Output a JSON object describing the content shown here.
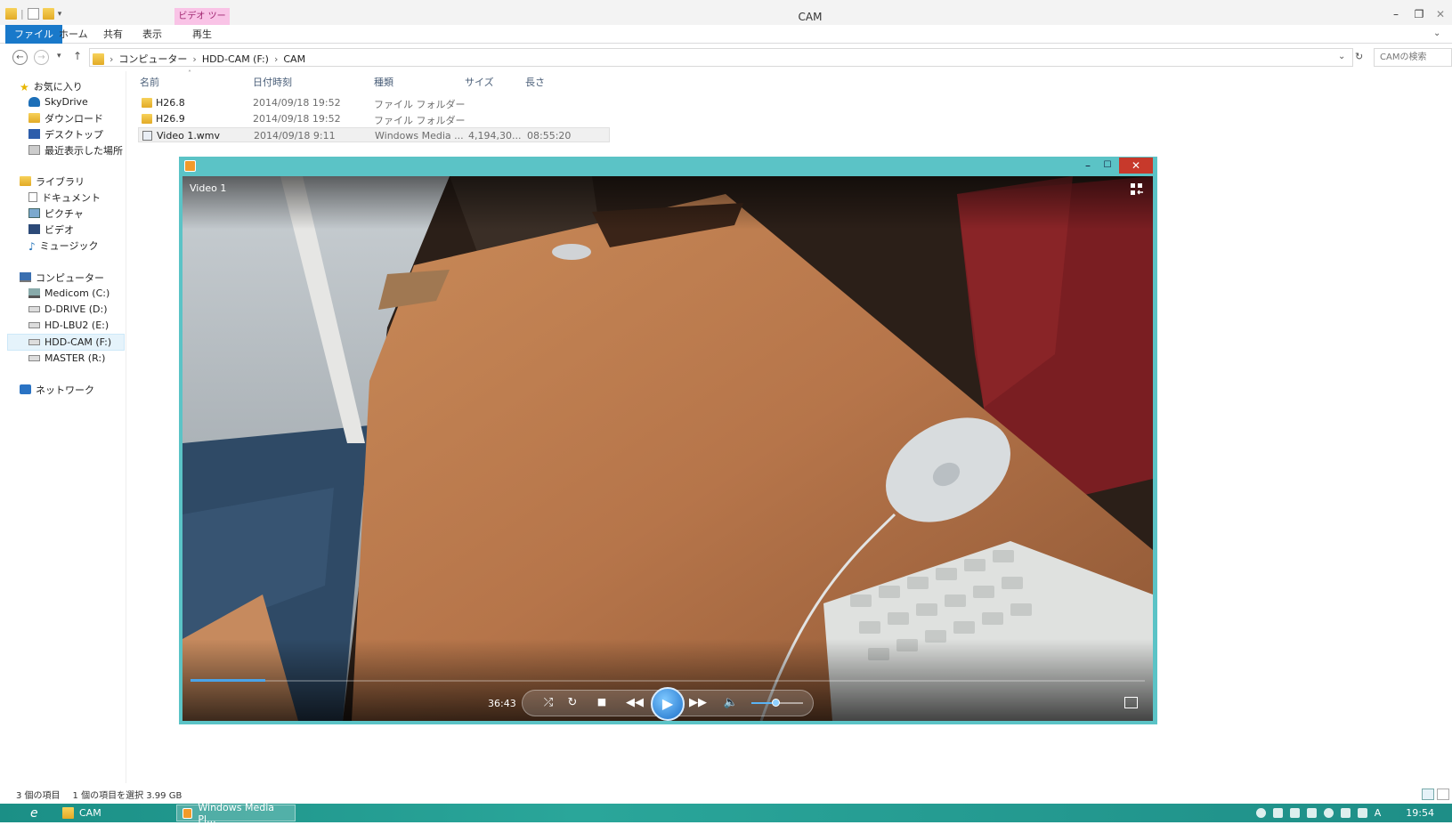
{
  "explorer": {
    "window_title": "CAM",
    "context_tab": "ビデオ ツール",
    "ribbon_tabs": [
      "ファイル",
      "ホーム",
      "共有",
      "表示",
      "再生"
    ],
    "breadcrumb": [
      "コンピューター",
      "HDD-CAM (F:)",
      "CAM"
    ],
    "search_placeholder": "CAMの検索",
    "nav": {
      "favorites": "お気に入り",
      "skydrive": "SkyDrive",
      "downloads": "ダウンロード",
      "desktop": "デスクトップ",
      "recent": "最近表示した場所",
      "libraries": "ライブラリ",
      "documents": "ドキュメント",
      "pictures": "ピクチャ",
      "videos": "ビデオ",
      "music": "ミュージック",
      "computer": "コンピューター",
      "drive_c": "Medicom (C:)",
      "drive_d": "D-DRIVE (D:)",
      "drive_e": "HD-LBU2 (E:)",
      "drive_f": "HDD-CAM (F:)",
      "drive_r": "MASTER (R:)",
      "network": "ネットワーク"
    },
    "columns": [
      "名前",
      "日付時刻",
      "種類",
      "サイズ",
      "長さ"
    ],
    "files": [
      {
        "name": "H26.8",
        "date": "2014/09/18 19:52",
        "type": "ファイル フォルダー",
        "size": "",
        "length": ""
      },
      {
        "name": "H26.9",
        "date": "2014/09/18 19:52",
        "type": "ファイル フォルダー",
        "size": "",
        "length": ""
      },
      {
        "name": "Video 1.wmv",
        "date": "2014/09/18 9:11",
        "type": "Windows Media ...",
        "size": "4,194,30...",
        "length": "08:55:20"
      }
    ],
    "status_count": "3 個の項目",
    "status_selection": "1 個の項目を選択  3.99 GB"
  },
  "player": {
    "video_title": "Video 1",
    "timecode": "36:43",
    "progress": 0.078,
    "volume": 0.46,
    "close_glyph": "✕",
    "min_glyph": "–",
    "max_glyph": "☐"
  },
  "taskbar": {
    "cam_label": "CAM",
    "wmp_label": "Windows Media Pl...",
    "ime": "A",
    "clock": "19:54"
  }
}
